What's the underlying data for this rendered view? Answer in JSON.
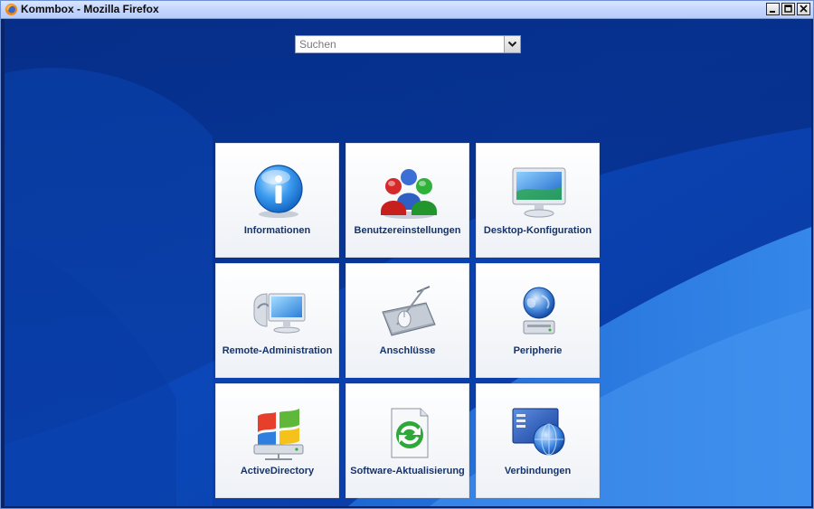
{
  "window": {
    "title": "Kommbox - Mozilla Firefox"
  },
  "search": {
    "placeholder": "Suchen"
  },
  "tiles": [
    {
      "label": "Informationen",
      "icon": "info-icon"
    },
    {
      "label": "Benutzereinstellungen",
      "icon": "users-icon"
    },
    {
      "label": "Desktop-Konfiguration",
      "icon": "monitor-icon"
    },
    {
      "label": "Remote-Administration",
      "icon": "remote-admin-icon"
    },
    {
      "label": "Anschlüsse",
      "icon": "mouse-pad-icon"
    },
    {
      "label": "Peripherie",
      "icon": "globe-drive-icon"
    },
    {
      "label": "ActiveDirectory",
      "icon": "windows-server-icon"
    },
    {
      "label": "Software-Aktualisierung",
      "icon": "update-icon"
    },
    {
      "label": "Verbindungen",
      "icon": "network-globe-icon"
    }
  ],
  "colors": {
    "background_dark": "#062a86",
    "background_light": "#2d7fe8",
    "tile_label": "#16336b"
  }
}
